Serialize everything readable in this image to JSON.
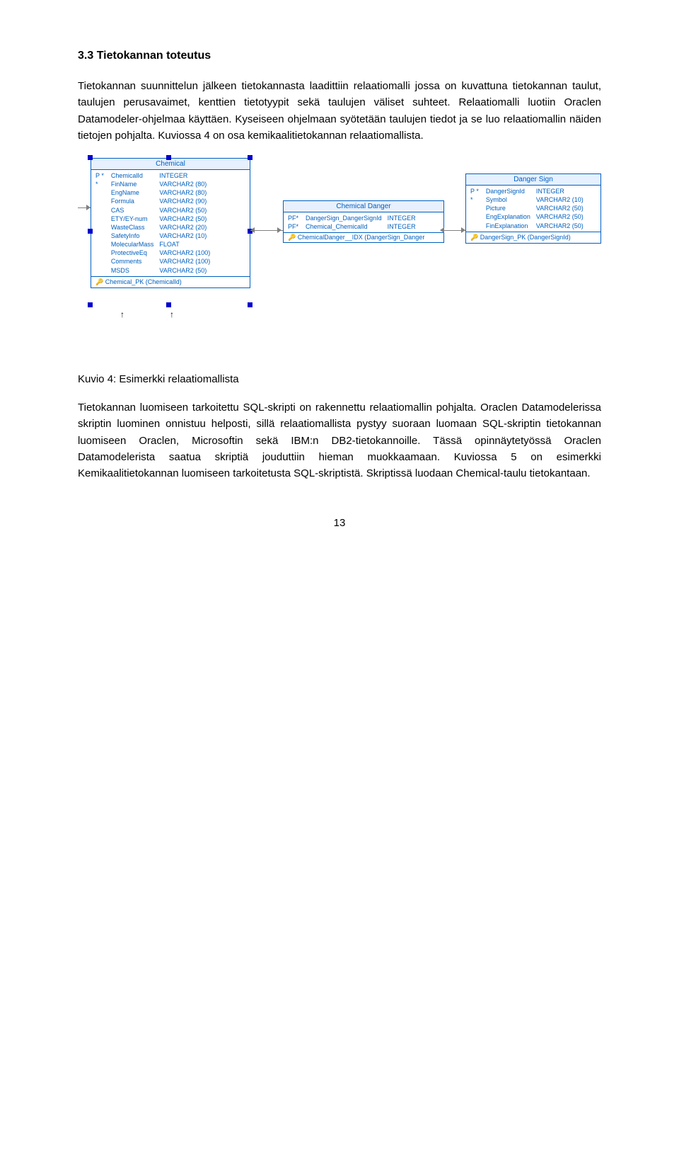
{
  "heading": "3.3 Tietokannan toteutus",
  "para1": "Tietokannan suunnittelun jälkeen tietokannasta laadittiin relaatiomalli jossa on kuvattuna tietokannan taulut, taulujen perusavaimet, kenttien tietotyypit sekä taulujen väliset suhteet. Relaatiomalli luotiin Oraclen Datamodeler-ohjelmaa käyttäen. Kyseiseen ohjelmaan syötetään taulujen tiedot ja se luo relaatiomallin näiden tietojen pohjalta. Kuviossa 4 on osa kemikaalitietokannan relaatiomallista.",
  "caption": "Kuvio 4: Esimerkki relaatiomallista",
  "para2": "Tietokannan luomiseen tarkoitettu SQL-skripti on rakennettu relaatiomallin pohjalta. Oraclen Datamodelerissa skriptin luominen onnistuu helposti, sillä relaatiomallista pystyy suoraan luomaan SQL-skriptin tietokannan luomiseen Oraclen, Microsoftin sekä IBM:n DB2-tietokannoille. Tässä opinnäytetyössä Oraclen Datamodelerista saatua skriptiä jouduttiin hieman muokkaamaan. Kuviossa 5 on esimerkki Kemikaalitietokannan luomiseen tarkoitetusta SQL-skriptistä. Skriptissä luodaan Chemical-taulu tietokantaan.",
  "pagenum": "13",
  "diagram": {
    "chemical": {
      "title": "Chemical",
      "cols": [
        {
          "m": "P *",
          "n": "ChemicalId",
          "t": "INTEGER"
        },
        {
          "m": "*",
          "n": "FinName",
          "t": "VARCHAR2 (80)"
        },
        {
          "m": "",
          "n": "EngName",
          "t": "VARCHAR2 (80)"
        },
        {
          "m": "",
          "n": "Formula",
          "t": "VARCHAR2 (90)"
        },
        {
          "m": "",
          "n": "CAS",
          "t": "VARCHAR2 (50)"
        },
        {
          "m": "",
          "n": "ETY/EY-num",
          "t": "VARCHAR2 (50)"
        },
        {
          "m": "",
          "n": "WasteClass",
          "t": "VARCHAR2 (20)"
        },
        {
          "m": "",
          "n": "SafetyInfo",
          "t": "VARCHAR2 (10)"
        },
        {
          "m": "",
          "n": "MolecularMass",
          "t": "FLOAT"
        },
        {
          "m": "",
          "n": "ProtectiveEq",
          "t": "VARCHAR2 (100)"
        },
        {
          "m": "",
          "n": "Comments",
          "t": "VARCHAR2 (100)"
        },
        {
          "m": "",
          "n": "MSDS",
          "t": "VARCHAR2 (50)"
        }
      ],
      "pk": "Chemical_PK (ChemicalId)"
    },
    "chemdanger": {
      "title": "Chemical Danger",
      "cols": [
        {
          "m": "PF*",
          "n": "DangerSign_DangerSignId",
          "t": "INTEGER"
        },
        {
          "m": "PF*",
          "n": "Chemical_ChemicalId",
          "t": "INTEGER"
        }
      ],
      "idx": "ChemicalDanger__IDX (DangerSign_Danger"
    },
    "dangersign": {
      "title": "Danger Sign",
      "cols": [
        {
          "m": "P *",
          "n": "DangerSignId",
          "t": "INTEGER"
        },
        {
          "m": "*",
          "n": "Symbol",
          "t": "VARCHAR2 (10)"
        },
        {
          "m": "",
          "n": "Picture",
          "t": "VARCHAR2 (50)"
        },
        {
          "m": "",
          "n": "EngExplanation",
          "t": "VARCHAR2 (50)"
        },
        {
          "m": "",
          "n": "FinExplanation",
          "t": "VARCHAR2 (50)"
        }
      ],
      "pk": "DangerSign_PK (DangerSignId)"
    }
  }
}
